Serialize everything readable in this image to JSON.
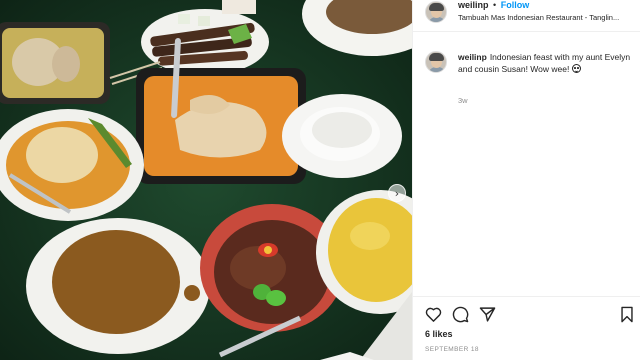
{
  "post": {
    "username": "weilinp",
    "separator": "•",
    "follow_label": "Follow",
    "location": "Tambuah Mas Indonesian Restaurant - Tanglin...",
    "caption_text": "Indonesian feast with my aunt Evelyn and cousin Susan! Wow wee!",
    "time_ago": "3w",
    "likes": "6 likes",
    "date": "SEPTEMBER 18"
  },
  "icons": {
    "like": "heart-icon",
    "comment": "comment-icon",
    "share": "paper-plane-icon",
    "save": "bookmark-icon",
    "next": "chevron-right-icon"
  },
  "colors": {
    "link": "#0095f6",
    "text": "#262626",
    "muted": "#8e8e8e",
    "table": "#16301f"
  }
}
